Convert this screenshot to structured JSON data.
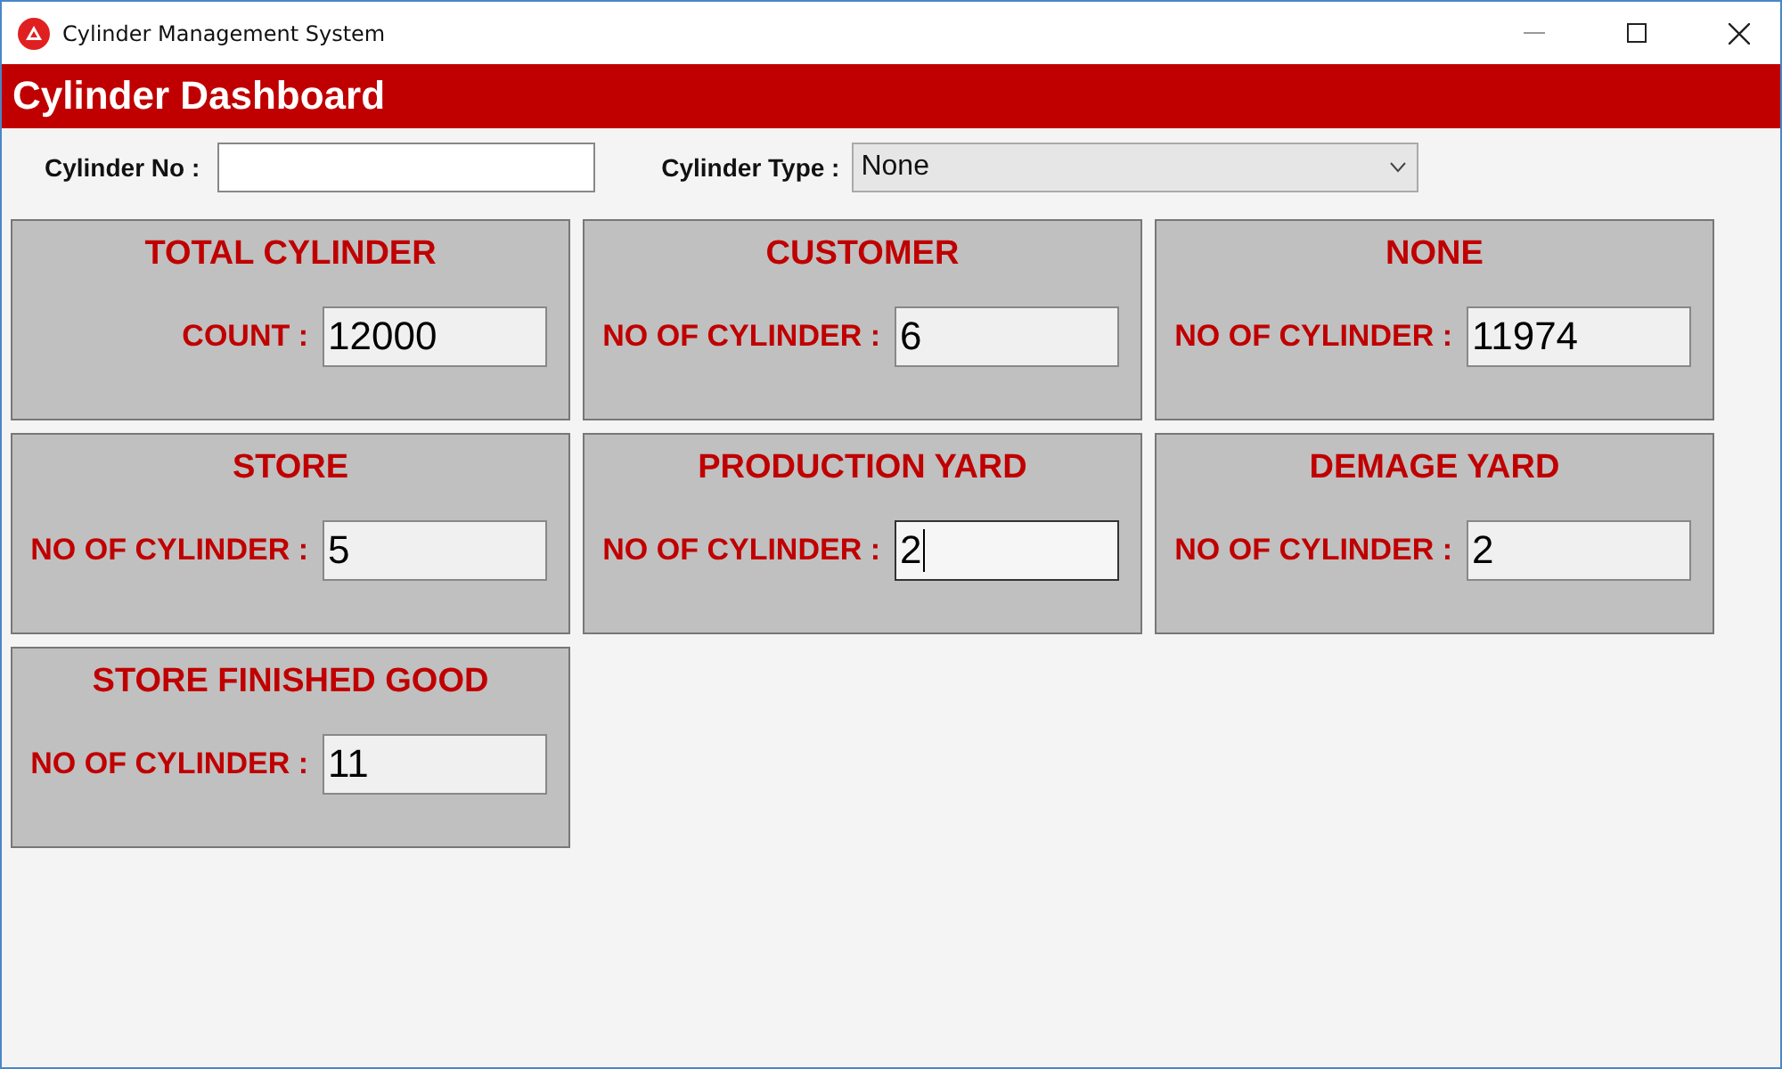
{
  "window": {
    "title": "Cylinder Management System"
  },
  "header": {
    "title": "Cylinder Dashboard"
  },
  "filters": {
    "cylinder_no": {
      "label": "Cylinder No :"
    },
    "cylinder_type": {
      "label": "Cylinder Type :",
      "value": "None"
    }
  },
  "cards": [
    {
      "title": "TOTAL CYLINDER",
      "label": "COUNT :",
      "value": "12000",
      "focused": false
    },
    {
      "title": "CUSTOMER",
      "label": "NO OF CYLINDER :",
      "value": "6",
      "focused": false
    },
    {
      "title": "NONE",
      "label": "NO OF CYLINDER :",
      "value": "11974",
      "focused": false
    },
    {
      "title": "STORE",
      "label": "NO OF CYLINDER :",
      "value": "5",
      "focused": false
    },
    {
      "title": "PRODUCTION YARD",
      "label": "NO OF CYLINDER :",
      "value": "2",
      "focused": true
    },
    {
      "title": "DEMAGE YARD",
      "label": "NO OF CYLINDER :",
      "value": "2",
      "focused": false
    },
    {
      "title": "STORE FINISHED GOOD",
      "label": "NO OF CYLINDER :",
      "value": "11",
      "focused": false
    }
  ]
}
